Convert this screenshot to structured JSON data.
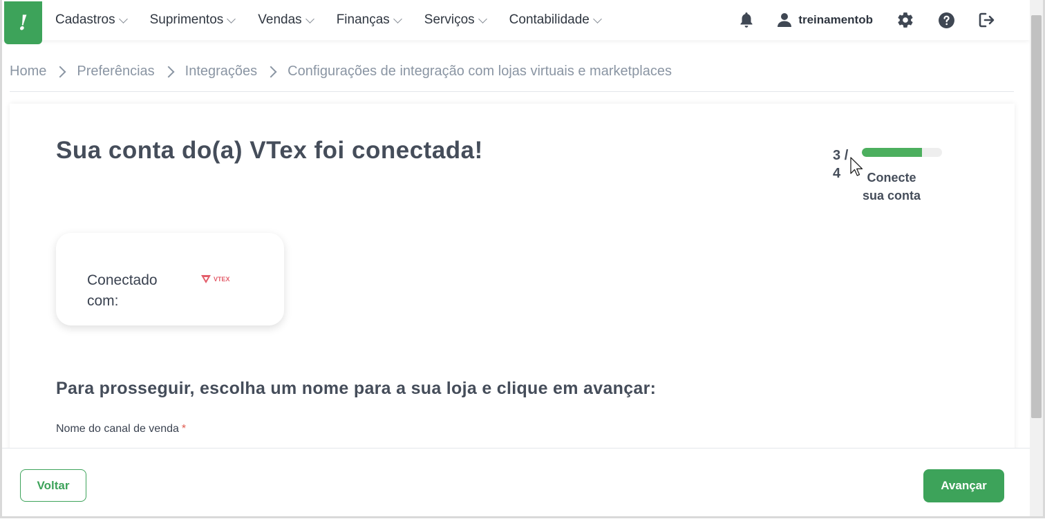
{
  "nav": {
    "logo_glyph": "!",
    "menu": [
      {
        "label": "Cadastros"
      },
      {
        "label": "Suprimentos"
      },
      {
        "label": "Vendas"
      },
      {
        "label": "Finanças"
      },
      {
        "label": "Serviços"
      },
      {
        "label": "Contabilidade"
      }
    ],
    "username": "treinamentob",
    "icons": [
      "bell-icon",
      "user-icon",
      "gear-icon",
      "help-icon",
      "logout-icon"
    ]
  },
  "breadcrumb": [
    {
      "label": "Home"
    },
    {
      "label": "Preferências"
    },
    {
      "label": "Integrações"
    },
    {
      "label": "Configurações de integração com lojas virtuais e marketplaces"
    }
  ],
  "main": {
    "title": "Sua conta do(a) VTex foi conectada!",
    "step": {
      "current": "3",
      "separator": "/",
      "total": "4",
      "label": "Conecte sua conta",
      "progress_fraction": 0.75
    },
    "connection": {
      "label": "Conectado com:",
      "logo_text": "VTEX"
    },
    "subtitle": "Para prosseguir, escolha um nome para a sua loja e clique em avançar:",
    "field": {
      "label": "Nome do canal de venda",
      "required_mark": "*"
    }
  },
  "footer": {
    "back_label": "Voltar",
    "next_label": "Avançar"
  },
  "colors": {
    "brand_green": "#3da35a",
    "progress_green": "#4caf5e",
    "vtex_pink": "#e35d6a"
  }
}
